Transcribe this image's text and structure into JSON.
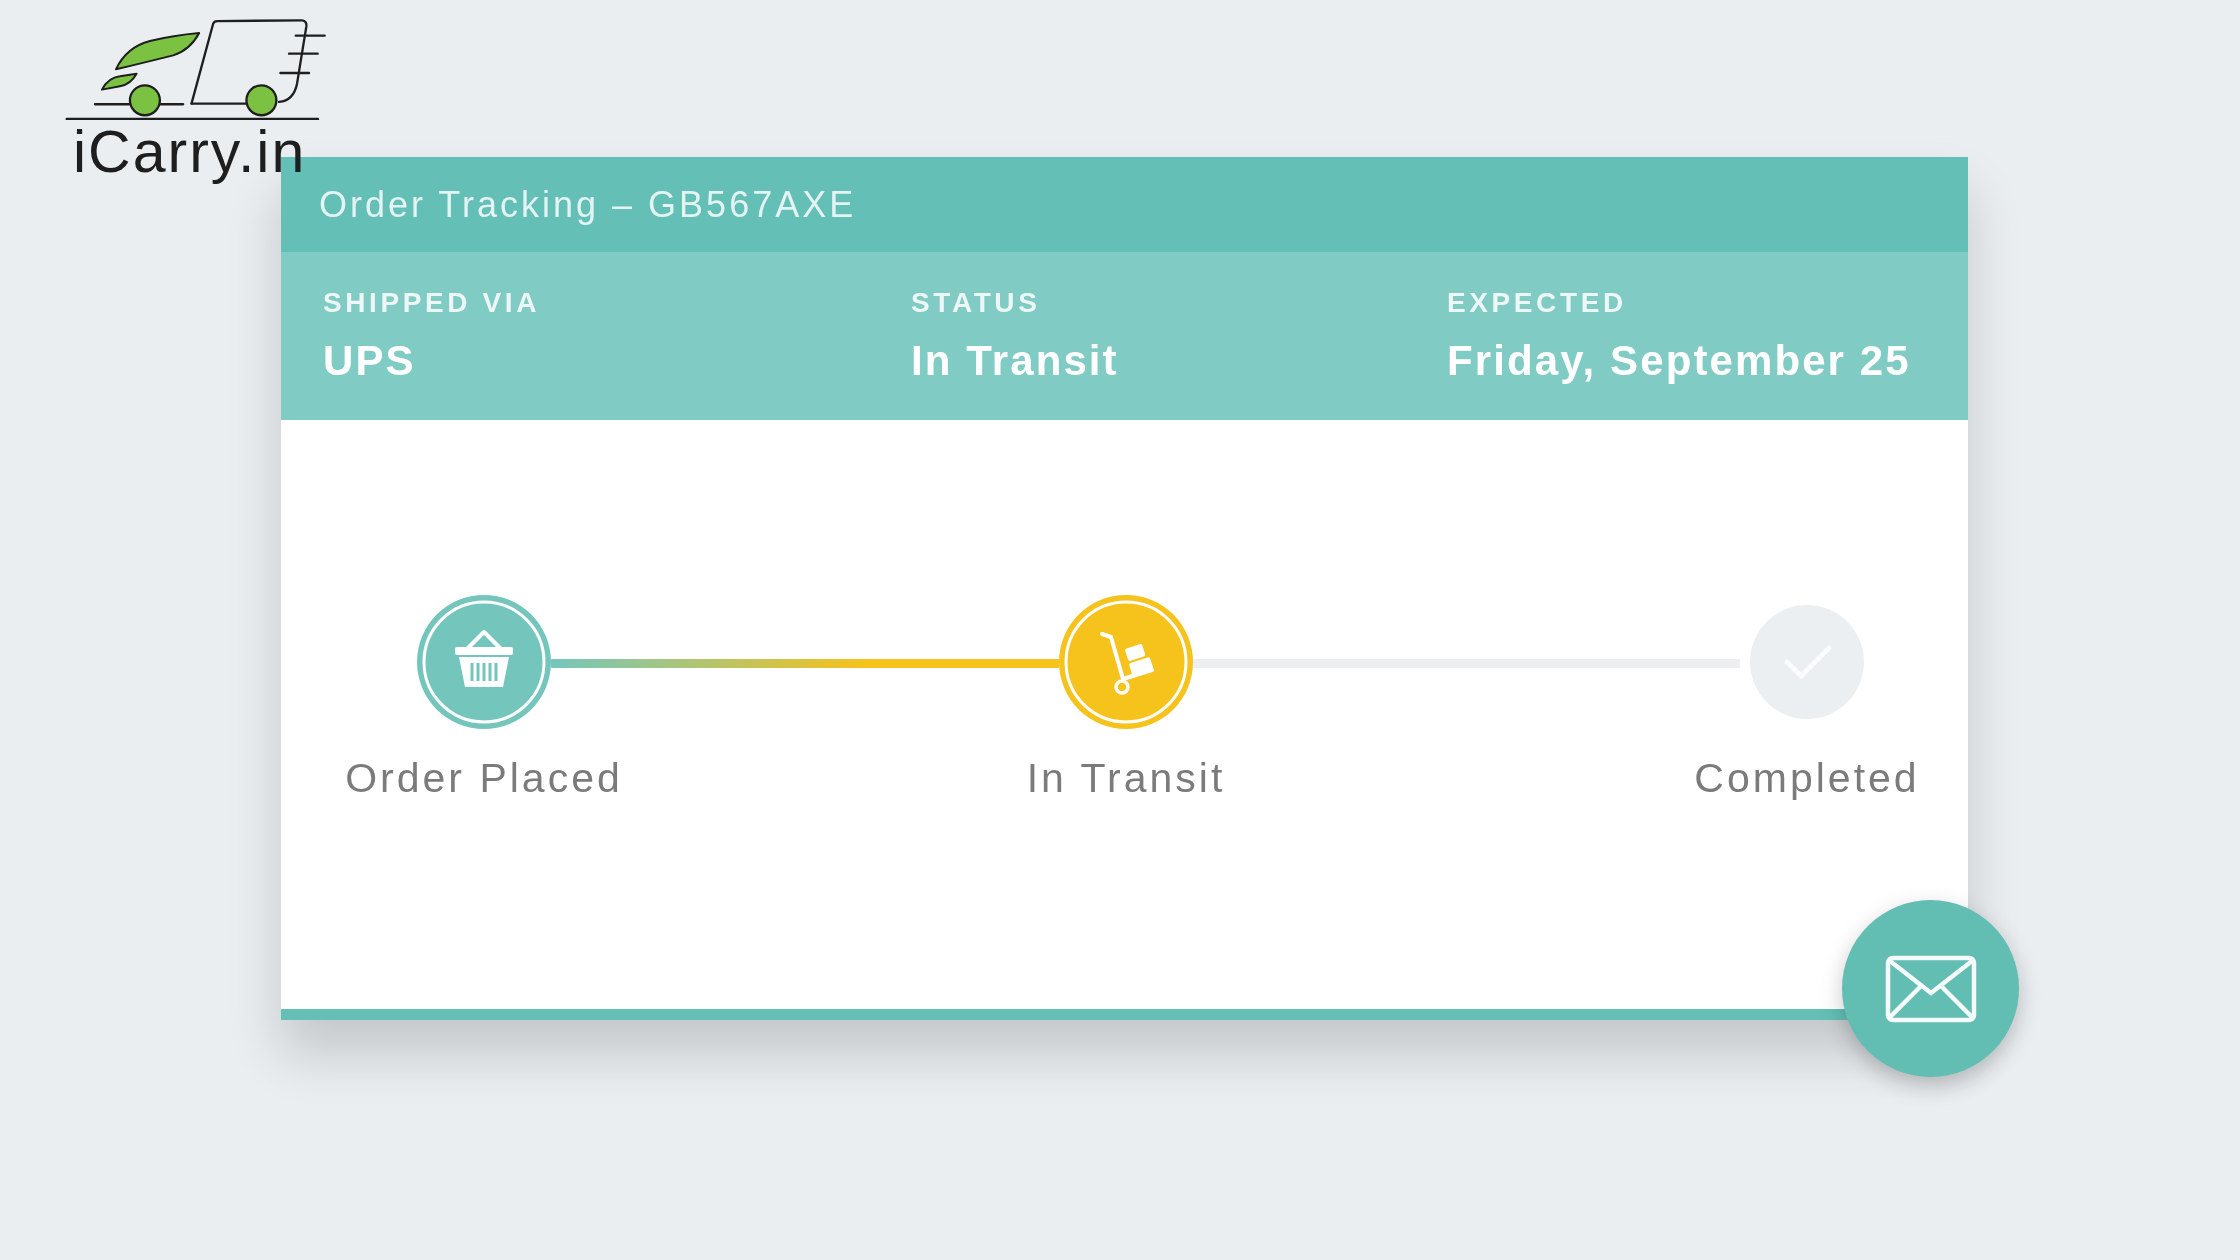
{
  "logo": {
    "text": "iCarry.in"
  },
  "header": {
    "title": "Order Tracking – GB567AXE"
  },
  "details": [
    {
      "label": "SHIPPED VIA",
      "value": "UPS"
    },
    {
      "label": "STATUS",
      "value": "In Transit"
    },
    {
      "label": "EXPECTED",
      "value": "Friday, September 25"
    }
  ],
  "steps": [
    {
      "label": "Order Placed",
      "kind": "done"
    },
    {
      "label": "In Transit",
      "kind": "current"
    },
    {
      "label": "Completed",
      "kind": "pending"
    }
  ]
}
